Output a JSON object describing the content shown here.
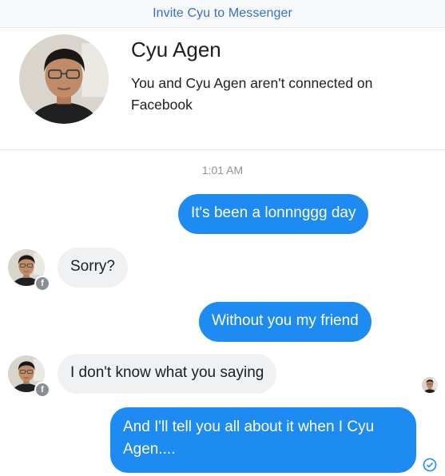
{
  "header": {
    "invite_label": "Invite Cyu to Messenger"
  },
  "profile": {
    "name": "Cyu Agen",
    "subtitle": "You and Cyu Agen aren't connected on Facebook"
  },
  "conversation": {
    "timestamp": "1:01 AM",
    "messages": [
      {
        "direction": "outgoing",
        "text": "It's been a lonnnggg day"
      },
      {
        "direction": "incoming",
        "text": "Sorry?"
      },
      {
        "direction": "outgoing",
        "text": "Without you my friend"
      },
      {
        "direction": "incoming",
        "text": "I don't know what you saying"
      },
      {
        "direction": "outgoing",
        "text": "And I'll tell you all about it when I Cyu Agen...."
      }
    ]
  },
  "colors": {
    "outgoing_bubble": "#1d8bf1",
    "incoming_bubble": "#f0f1f3",
    "link": "#3b6fc9",
    "timestamp": "#8d949e"
  },
  "icons": {
    "facebook_badge": "facebook-badge-icon",
    "sent_status": "sent-check-icon"
  }
}
